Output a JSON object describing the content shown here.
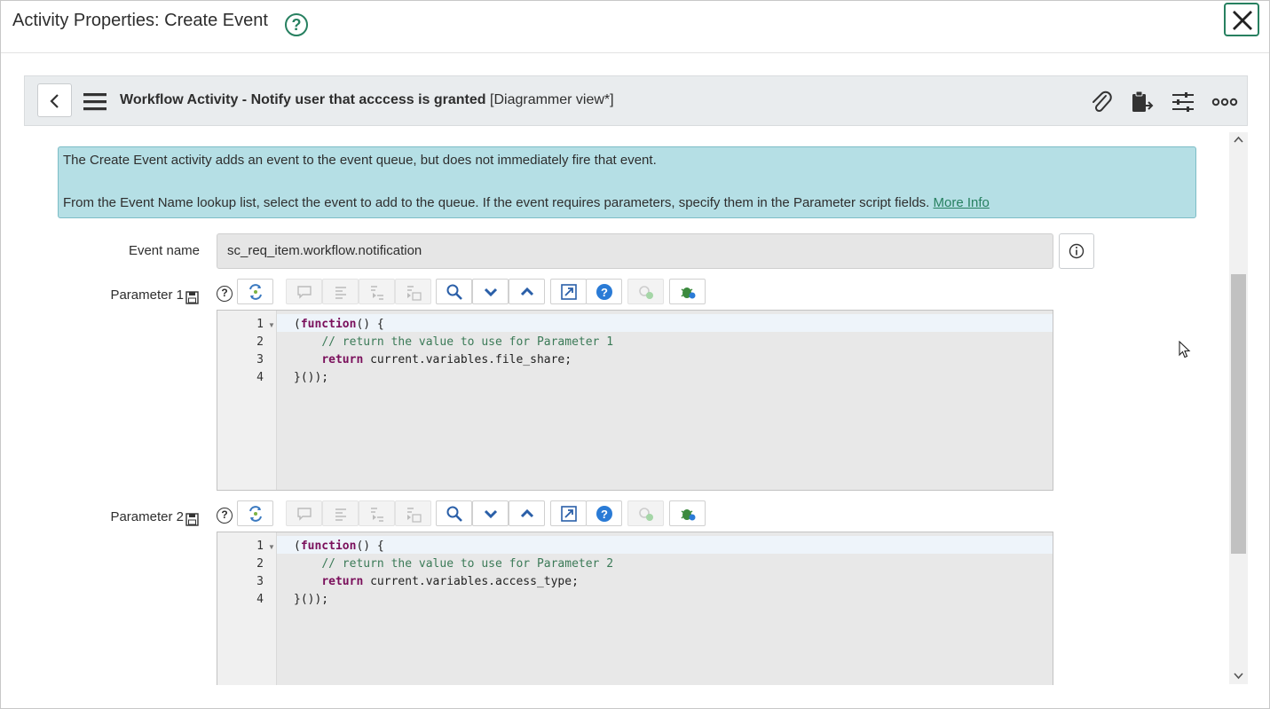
{
  "dialog": {
    "title": "Activity Properties: Create Event",
    "help_icon": "question-circle-icon",
    "close_icon": "close-icon"
  },
  "form_bar": {
    "title_bold": "Workflow Activity - Notify user that acccess is granted",
    "view": "[Diagrammer view*]",
    "icons": [
      "back-icon",
      "hamburger-menu-icon",
      "paperclip-icon",
      "clipboard-export-icon",
      "sliders-icon",
      "more-icon"
    ]
  },
  "info_box": {
    "line1": "The Create Event activity adds an event to the event queue, but does not immediately fire that event.",
    "line2": "From the Event Name lookup list, select the event to add to the queue. If the event requires parameters, specify them in the Parameter script fields.",
    "link": "More Info"
  },
  "event_name": {
    "label": "Event name",
    "value": "sc_req_item.workflow.notification"
  },
  "parameters": [
    {
      "label": "Parameter 1",
      "lines": [
        "1",
        "2",
        "3",
        "4"
      ],
      "code": [
        {
          "a": "(",
          "kw": "function",
          "b": "() {"
        },
        {
          "indent": "    ",
          "comment": "// return the value to use for Parameter 1"
        },
        {
          "indent": "    ",
          "kw": "return",
          "b": " current.variables.file_share;"
        },
        {
          "a": "}());"
        }
      ]
    },
    {
      "label": "Parameter 2",
      "lines": [
        "1",
        "2",
        "3",
        "4"
      ],
      "code": [
        {
          "a": "(",
          "kw": "function",
          "b": "() {"
        },
        {
          "indent": "    ",
          "comment": "// return the value to use for Parameter 2"
        },
        {
          "indent": "    ",
          "kw": "return",
          "b": " current.variables.access_type;"
        },
        {
          "a": "}());"
        }
      ]
    }
  ],
  "colors": {
    "accent": "#278060",
    "info_bg": "#b5dfe5",
    "keyword": "#7a0f5b",
    "comment": "#3b7a57"
  }
}
